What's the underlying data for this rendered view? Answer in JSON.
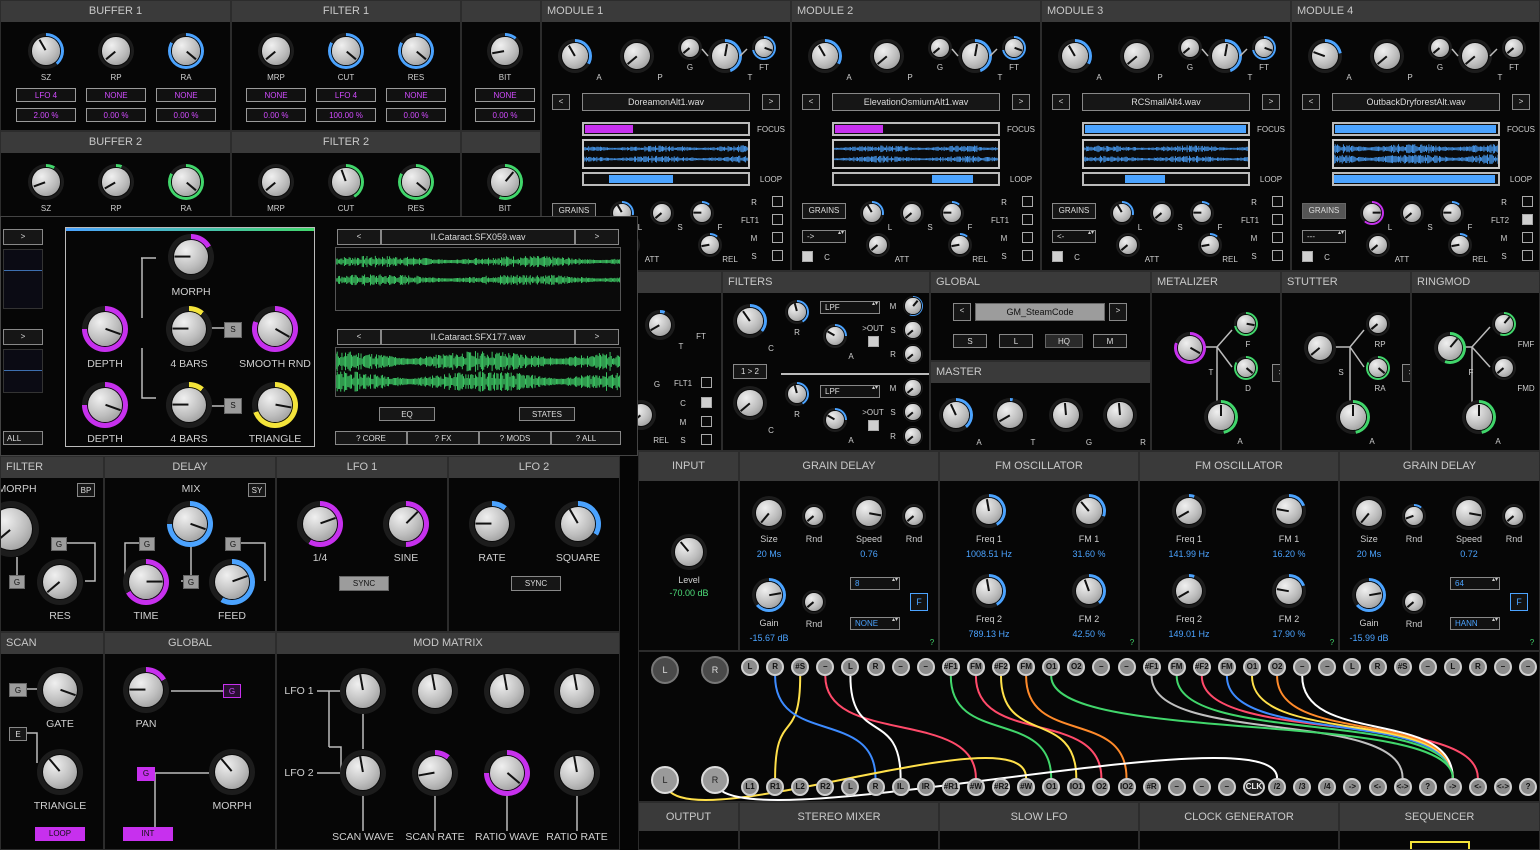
{
  "buffer1": {
    "title": "BUFFER 1",
    "labels": [
      "SZ",
      "RP",
      "RA"
    ],
    "mods": [
      "LFO 4",
      "NONE",
      "NONE"
    ],
    "vals": [
      "2.00 %",
      "0.00 %",
      "0.00 %"
    ]
  },
  "filter1": {
    "title": "FILTER 1",
    "labels": [
      "MRP",
      "CUT",
      "RES"
    ],
    "mods": [
      "NONE",
      "LFO 4",
      "NONE"
    ],
    "vals": [
      "0.00 %",
      "100.00 %",
      "0.00 %"
    ]
  },
  "bit1": {
    "label": "BIT",
    "mod": "NONE",
    "val": "0.00 %"
  },
  "buffer2": {
    "title": "BUFFER 2",
    "labels": [
      "SZ",
      "RP",
      "RA"
    ]
  },
  "filter2": {
    "title": "FILTER 2",
    "labels": [
      "MRP",
      "CUT",
      "RES"
    ]
  },
  "bit2": {
    "label": "BIT"
  },
  "modules": [
    {
      "title": "MODULE 1",
      "file": "DoreamonAlt1.wav",
      "mode": "GRAINS",
      "side": "FLT1"
    },
    {
      "title": "MODULE 2",
      "file": "ElevationOsmiumAlt1.wav",
      "mode": "GRAINS",
      "side": "FLT1"
    },
    {
      "title": "MODULE 3",
      "file": "RCSmallAlt4.wav",
      "mode": "GRAINS",
      "side": "FLT1"
    },
    {
      "title": "MODULE 4",
      "file": "OutbackDryforestAlt.wav",
      "mode": "GRAINS",
      "side": "FLT2"
    }
  ],
  "module_labels": {
    "knobs": [
      "A",
      "P",
      "G",
      "T",
      "FT"
    ],
    "focus": "FOCUS",
    "loop": "LOOP",
    "prev": "<",
    "next": ">",
    "grain_knobs": [
      "L",
      "S",
      "F"
    ],
    "bottom": [
      "ATT",
      "REL"
    ],
    "c": "C",
    "checks": [
      "R",
      "M",
      "S"
    ],
    "dir": [
      "->",
      "->",
      "<-",
      "---"
    ]
  },
  "overlay": {
    "morph": "MORPH",
    "depth": "DEPTH",
    "bars": "4 BARS",
    "smooth": "SMOOTH RND",
    "triangle": "TRIANGLE",
    "s": "S",
    "file1": "II.Cataract.SFX059.wav",
    "file2": "II.Cataract.SFX177.wav",
    "eq": "EQ",
    "states": "STATES",
    "help": [
      "? CORE",
      "? FX",
      "? MODS",
      "? ALL"
    ],
    "all": "ALL",
    "next": ">",
    "prev": "<"
  },
  "filters": {
    "title": "FILTERS",
    "types": [
      "LPF",
      "LPF"
    ],
    "out": ">OUT",
    "route": "1 > 2",
    "labels": [
      "C",
      "R",
      "A",
      "M",
      "S",
      "R"
    ]
  },
  "global": {
    "title": "GLOBAL",
    "preset": "GM_SteamCode",
    "buttons": [
      "S",
      "L",
      "HQ",
      "M"
    ],
    "prev": "<",
    "next": ">"
  },
  "master": {
    "title": "MASTER",
    "labels": [
      "A",
      "T",
      "G",
      "R"
    ]
  },
  "metalizer": {
    "title": "METALIZER",
    "labels": [
      "T",
      "F",
      "D",
      "A"
    ]
  },
  "stutter": {
    "title": "STUTTER",
    "labels": [
      "S",
      "RP",
      "RA",
      "A"
    ]
  },
  "ringmod": {
    "title": "RINGMOD",
    "labels": [
      "F",
      "FMF",
      "FMD",
      "A"
    ]
  },
  "left_partial": {
    "labels": [
      "T",
      "FT",
      "G",
      "FLT1",
      "C",
      "M",
      "REL",
      "S"
    ]
  },
  "filter_b": {
    "title": "FILTER",
    "morph": "MORPH",
    "bp": "BP",
    "res": "RES",
    "g": "G"
  },
  "delay": {
    "title": "DELAY",
    "mix": "MIX",
    "sy": "SY",
    "time": "TIME",
    "feed": "FEED",
    "g": "G"
  },
  "lfo1": {
    "title": "LFO 1",
    "k1": "1/4",
    "k2": "SINE",
    "sync": "SYNC"
  },
  "lfo2": {
    "title": "LFO 2",
    "k1": "RATE",
    "k2": "SQUARE",
    "sync": "SYNC"
  },
  "scan": {
    "title": "SCAN",
    "gate": "GATE",
    "triangle": "TRIANGLE",
    "loop": "LOOP",
    "g": "G",
    "e": "E"
  },
  "global_b": {
    "title": "GLOBAL",
    "pan": "PAN",
    "morph": "MORPH",
    "int": "INT",
    "g": "G"
  },
  "modmatrix": {
    "title": "MOD MATRIX",
    "rows": [
      "LFO 1",
      "LFO 2"
    ],
    "cols": [
      "SCAN WAVE",
      "SCAN RATE",
      "RATIO WAVE",
      "RATIO RATE"
    ]
  },
  "input": {
    "title": "INPUT",
    "level": "Level",
    "value": "-70.00 dB"
  },
  "grain_delay1": {
    "title": "GRAIN DELAY",
    "size": "Size",
    "size_val": "20 Ms",
    "rnd": "Rnd",
    "speed": "Speed",
    "speed_val": "0.76",
    "gain": "Gain",
    "gain_val": "-15.67 dB",
    "num": "8",
    "win": "NONE",
    "f": "F",
    "q": "?"
  },
  "fm1": {
    "title": "FM OSCILLATOR",
    "freq1": "Freq 1",
    "freq1_val": "1008.51 Hz",
    "fm1": "FM 1",
    "fm1_val": "31.60 %",
    "freq2": "Freq 2",
    "freq2_val": "789.13 Hz",
    "fm2": "FM 2",
    "fm2_val": "42.50 %",
    "q": "?"
  },
  "fm2": {
    "title": "FM OSCILLATOR",
    "freq1": "Freq 1",
    "freq1_val": "141.99 Hz",
    "fm1": "FM 1",
    "fm1_val": "16.20 %",
    "freq2": "Freq 2",
    "freq2_val": "149.01 Hz",
    "fm2": "FM 2",
    "fm2_val": "17.90 %",
    "q": "?"
  },
  "grain_delay2": {
    "title": "GRAIN DELAY",
    "size": "Size",
    "size_val": "20 Ms",
    "rnd": "Rnd",
    "speed": "Speed",
    "speed_val": "0.72",
    "gain": "Gain",
    "gain_val": "-15.99 dB",
    "num": "64",
    "win": "HANN",
    "f": "F",
    "q": "?"
  },
  "patch": {
    "left_big": [
      "L",
      "R"
    ],
    "top": [
      "L",
      "R",
      "#S",
      "–",
      "L",
      "R",
      "–",
      "–",
      "#F1",
      "FM",
      "#F2",
      "FM",
      "O1",
      "O2",
      "–",
      "–",
      "#F1",
      "FM",
      "#F2",
      "FM",
      "O1",
      "O2",
      "–",
      "–",
      "L",
      "R",
      "#S",
      "–",
      "L",
      "R",
      "–",
      "–"
    ],
    "bottom": [
      "L1",
      "R1",
      "L2",
      "R2",
      "L",
      "R",
      "IL",
      "IR",
      "#R1",
      "#W",
      "#R2",
      "#W",
      "O1",
      "IO1",
      "O2",
      "IO2",
      "#R",
      "–",
      "–",
      "–",
      "CLK",
      "/2",
      "/3",
      "/4",
      "->",
      "<-",
      "<->",
      "?",
      "->",
      "<-",
      "<->",
      "?"
    ],
    "cable_colors": [
      "#ffe04a",
      "#3d8bff",
      "#ff4a6a",
      "#ffffff",
      "#41d66b",
      "#ff8a2a",
      "#c0c0c0"
    ]
  },
  "bottom_titles": [
    "OUTPUT",
    "STEREO MIXER",
    "SLOW LFO",
    "CLOCK GENERATOR",
    "SEQUENCER"
  ],
  "colors": {
    "blue": "#4ba3ff",
    "green": "#41d66b",
    "purple": "#c730ee",
    "yellow": "#f4e43a",
    "header": "#3a3a3a"
  }
}
